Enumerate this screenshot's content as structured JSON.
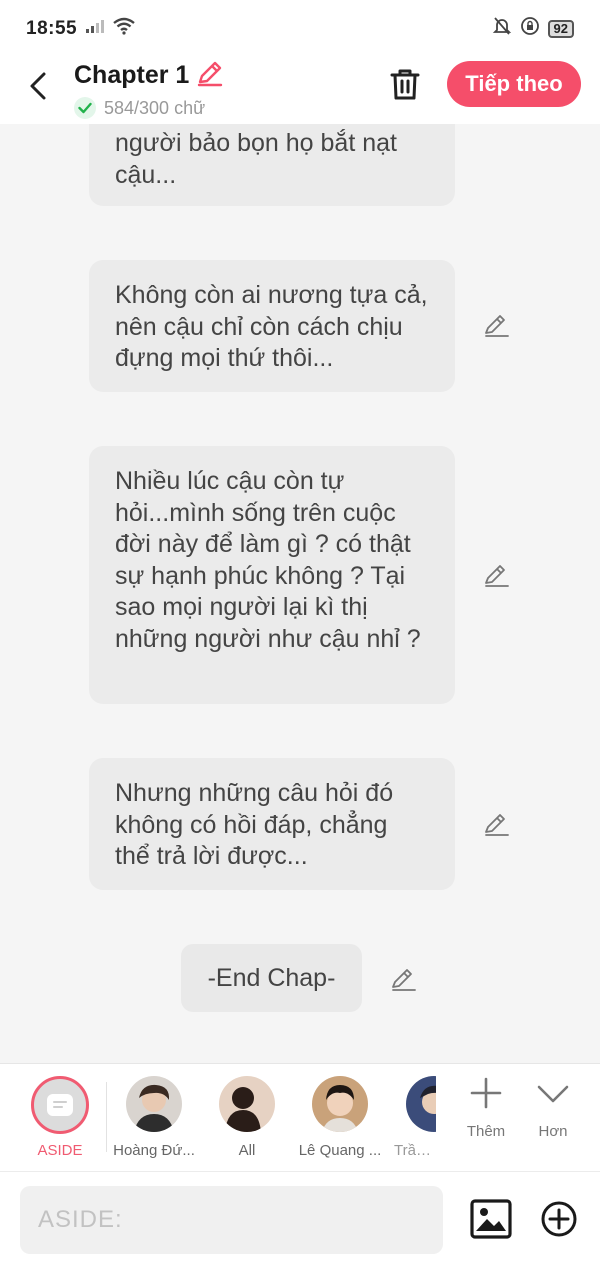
{
  "status_bar": {
    "time": "18:55",
    "battery": "92"
  },
  "header": {
    "title": "Chapter 1",
    "word_count": "584/300 chữ",
    "next_label": "Tiếp theo",
    "accent_color": "#f54e6a"
  },
  "messages": [
    {
      "text": "người bảo bọn họ bắt nạt cậu..."
    },
    {
      "text": "Không còn ai nương tựa cả, nên cậu chỉ còn cách chịu đựng mọi thứ thôi..."
    },
    {
      "text": "Nhiều lúc cậu còn tự hỏi...mình sống trên cuộc đời này để làm gì ? có thật sự hạnh phúc không ? Tại sao mọi người lại kì thị những người như cậu nhỉ ?"
    },
    {
      "text": "Nhưng những câu hỏi đó không có hồi đáp, chẳng thể trả lời được..."
    },
    {
      "text": "-End Chap-"
    }
  ],
  "characters": [
    {
      "name": "ASIDE",
      "selected": true
    },
    {
      "name": "Hoàng Đứ..."
    },
    {
      "name": "All"
    },
    {
      "name": "Lê Quang ..."
    },
    {
      "name": "Trần Đ"
    }
  ],
  "tools": {
    "more_label": "Thêm",
    "expand_label": "Hơn"
  },
  "input": {
    "placeholder": "ASIDE:"
  }
}
